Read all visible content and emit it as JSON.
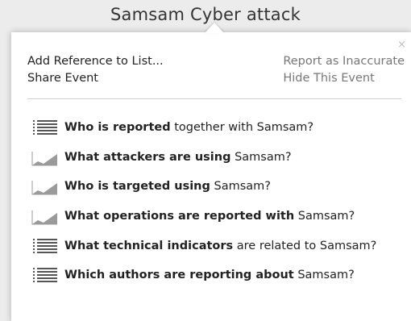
{
  "event_title": "Samsam Cyber attack",
  "actions": {
    "add_reference": "Add Reference to List...",
    "share_event": "Share Event",
    "report_inaccurate": "Report as Inaccurate",
    "hide_event": "Hide This Event",
    "close_symbol": "×"
  },
  "queries": [
    {
      "icon": "list-icon",
      "bold": "Who is reported",
      "rest": " together with Samsam?"
    },
    {
      "icon": "area-chart-icon",
      "bold": "What attackers are using",
      "rest": " Samsam?"
    },
    {
      "icon": "area-chart-icon",
      "bold": "Who is targeted using",
      "rest": " Samsam?"
    },
    {
      "icon": "area-chart-icon",
      "bold": "What operations are reported with",
      "rest": " Samsam?"
    },
    {
      "icon": "list-icon",
      "bold": "What technical indicators",
      "rest": " are related to Samsam?"
    },
    {
      "icon": "list-icon",
      "bold": "Which authors are reporting about",
      "rest": " Samsam?"
    }
  ],
  "colors": {
    "icon": "#555555",
    "background": "#ececec",
    "panel": "#ffffff"
  }
}
